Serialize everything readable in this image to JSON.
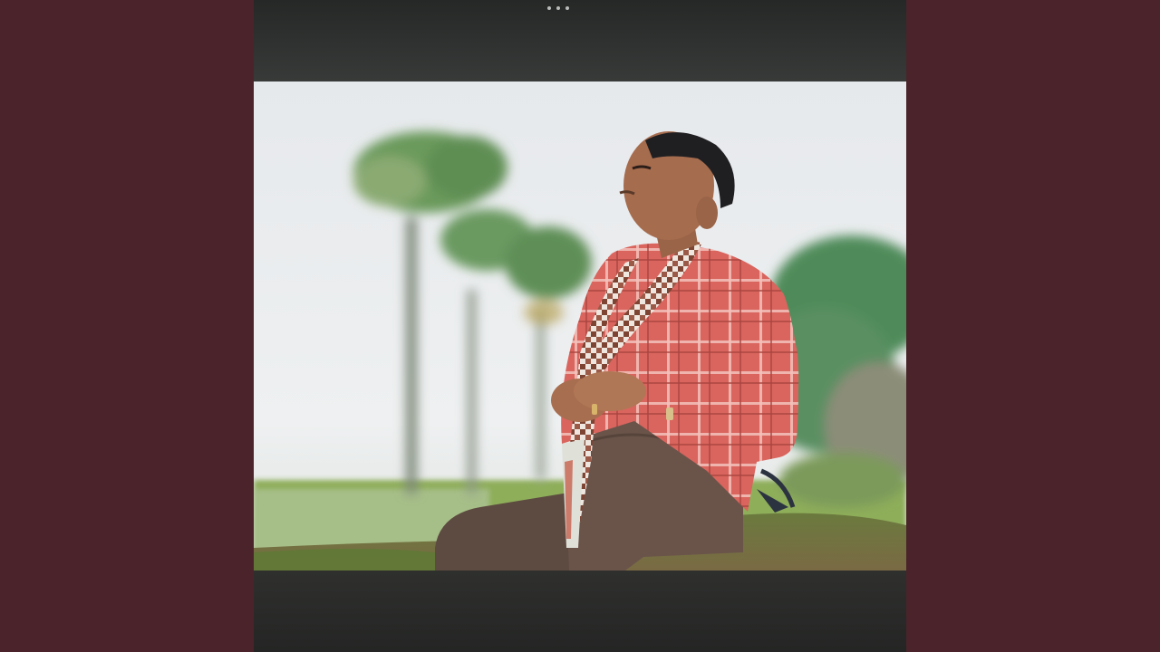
{
  "page": {
    "background_color": "#4a242a",
    "frame_color": "#2b2d2c"
  },
  "toolbar": {
    "menu_icon": "more-horizontal-icon"
  },
  "photo": {
    "subject": "man-sitting-on-grass",
    "shirt_color": "#d9655e",
    "scarf_color": "#8a5040",
    "trousers_color": "#5d4a40",
    "sky_color": "#e9ecef",
    "palm_color": "#4e8a55",
    "grass_color": "#6d8f3e"
  }
}
